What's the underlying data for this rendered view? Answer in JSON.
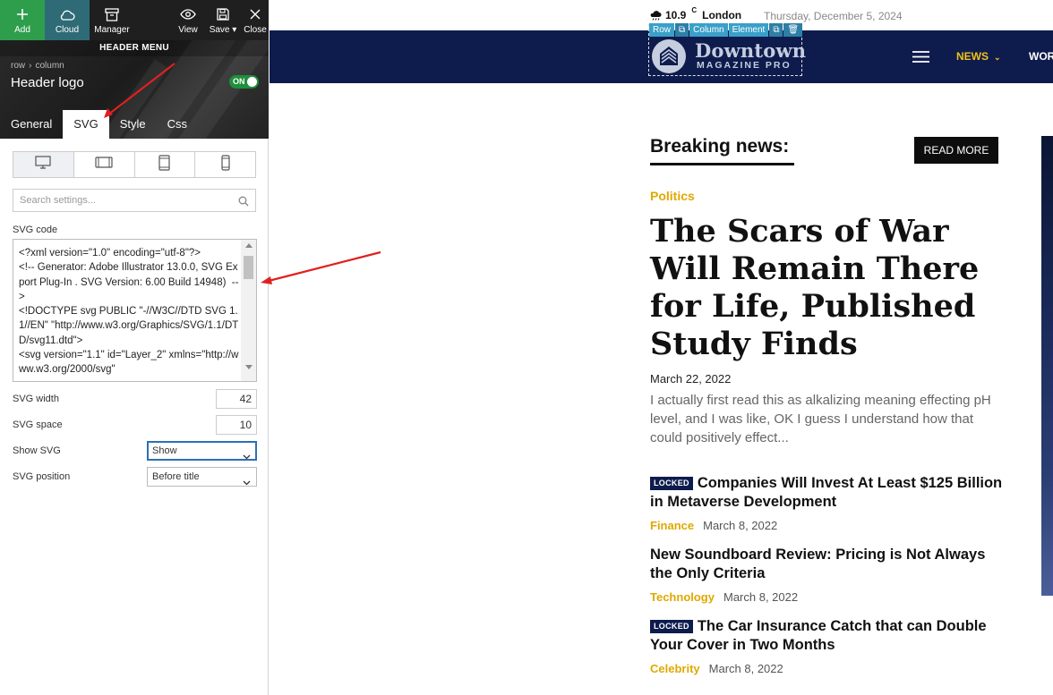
{
  "toolbar": {
    "add": "Add",
    "cloud": "Cloud",
    "manager": "Manager",
    "view": "View",
    "save": "Save",
    "close": "Close"
  },
  "panel": {
    "header_title": "HEADER MENU",
    "breadcrumb": [
      "row",
      "column"
    ],
    "element_name": "Header logo",
    "toggle_label": "ON",
    "tabs": [
      "General",
      "SVG",
      "Style",
      "Css"
    ],
    "active_tab": "SVG",
    "devices": [
      "desktop-icon",
      "tablet-landscape-icon",
      "tablet-portrait-icon",
      "mobile-icon"
    ],
    "search_placeholder": "Search settings...",
    "svg_code_label": "SVG code",
    "svg_code": "<?xml version=\"1.0\" encoding=\"utf-8\"?>\n<!-- Generator: Adobe Illustrator 13.0.0, SVG Export Plug-In . SVG Version: 6.00 Build 14948)  -->\n<!DOCTYPE svg PUBLIC \"-//W3C//DTD SVG 1.1//EN\" \"http://www.w3.org/Graphics/SVG/1.1/DTD/svg11.dtd\">\n<svg version=\"1.1\" id=\"Layer_2\" xmlns=\"http://www.w3.org/2000/svg\"",
    "svg_width_label": "SVG width",
    "svg_width": "42",
    "svg_space_label": "SVG space",
    "svg_space": "10",
    "show_svg_label": "Show SVG",
    "show_svg_value": "Show",
    "svg_position_label": "SVG position",
    "svg_position_value": "Before title"
  },
  "site": {
    "weather_temp": "10.9",
    "weather_unit": "C",
    "weather_city": "London",
    "date": "Thursday, December 5, 2024",
    "selection_toolbar": [
      "Row",
      "Column",
      "Element"
    ],
    "logo_line1": "Downtown",
    "logo_line2": "MAGAZINE PRO",
    "nav_news": "NEWS",
    "nav_next": "WOR",
    "breaking_title": "Breaking news:",
    "read_more": "READ MORE",
    "main_category": "Politics",
    "main_title": "The Scars of War Will Remain There for Life, Published Study Finds",
    "main_date": "March 22, 2022",
    "main_excerpt": "I actually first read this as alkalizing meaning effecting pH level, and I was like, OK I guess I understand how that could positively effect...",
    "articles": [
      {
        "locked": "LOCKED",
        "title": "Companies Will Invest At Least $125 Billion in Metaverse Development",
        "category": "Finance",
        "date": "March 8, 2022"
      },
      {
        "locked": "",
        "title": "New Soundboard Review: Pricing is Not Always the Only Criteria",
        "category": "Technology",
        "date": "March 8, 2022"
      },
      {
        "locked": "LOCKED",
        "title": "The Car Insurance Catch that can Double Your Cover in Two Months",
        "category": "Celebrity",
        "date": "March 8, 2022"
      }
    ]
  },
  "colors": {
    "navbar": "#0e1c4d",
    "accent_yellow": "#e0a800",
    "add_green": "#2e9e4d",
    "annotation_red": "#e02020"
  }
}
